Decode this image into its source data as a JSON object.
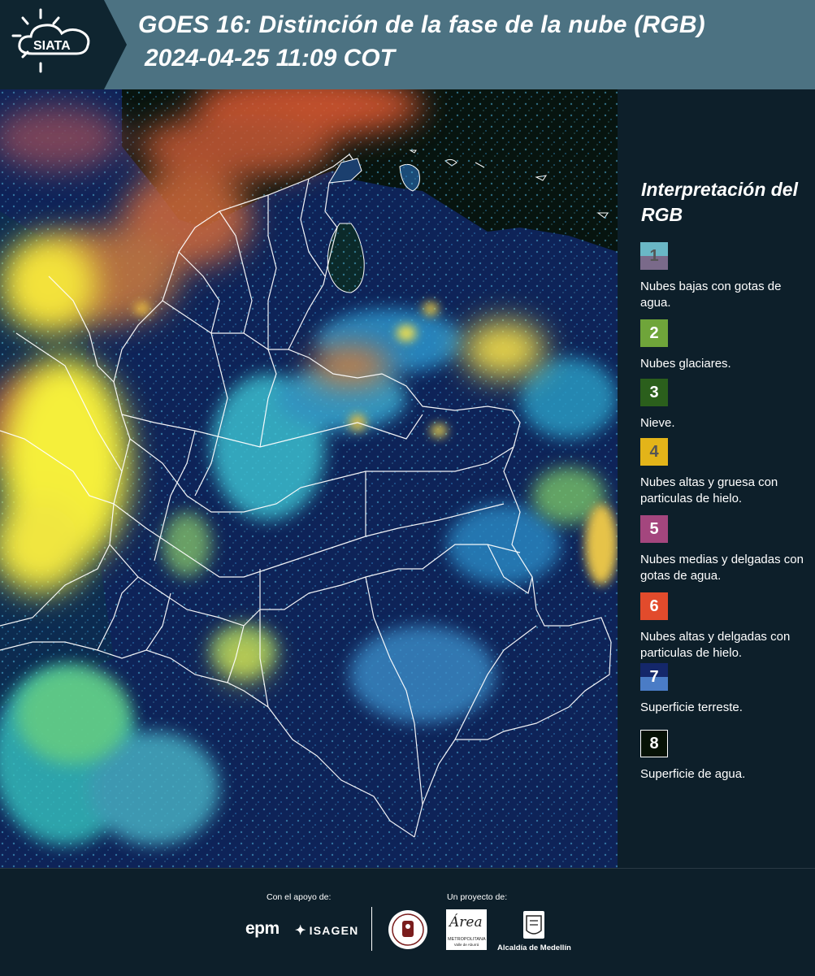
{
  "header": {
    "logo_text": "SIATA",
    "title_line1": "GOES 16: Distinción de la fase de la nube (RGB)",
    "title_line2": "2024-04-25 11:09 COT",
    "background_color": "#4c7282"
  },
  "legend": {
    "title": "Interpretación del RGB",
    "items": [
      {
        "number": "1",
        "label": "Nubes bajas con gotas de agua.",
        "color_top": "#6ab7c6",
        "color_bottom": "#7a6a8a",
        "text_color": "#555555"
      },
      {
        "number": "2",
        "label": "Nubes glaciares.",
        "color_top": "#6fa53a",
        "color_bottom": "#6fa53a",
        "text_color": "#ffffff"
      },
      {
        "number": "3",
        "label": "Nieve.",
        "color_top": "#2b5f1c",
        "color_bottom": "#2b5f1c",
        "text_color": "#ffffff"
      },
      {
        "number": "4",
        "label": "Nubes altas y gruesa con particulas de hielo.",
        "color_top": "#e3b419",
        "color_bottom": "#e3b419",
        "text_color": "#555555"
      },
      {
        "number": "5",
        "label": "Nubes medias y delgadas con gotas de agua.",
        "color_top": "#a4467e",
        "color_bottom": "#a4467e",
        "text_color": "#ffffff"
      },
      {
        "number": "6",
        "label": "Nubes altas y delgadas con particulas de hielo.",
        "color_top": "#e24b2c",
        "color_bottom": "#e24b2c",
        "text_color": "#ffffff"
      },
      {
        "number": "7",
        "label": "Superficie terreste.",
        "color_top": "#14276a",
        "color_bottom": "#4a7cc6",
        "text_color": "#ffffff"
      },
      {
        "number": "8",
        "label": "Superficie de agua.",
        "color_top": "#061206",
        "color_bottom": "#061206",
        "text_color": "#ffffff"
      }
    ]
  },
  "footer": {
    "support_label": "Con el apoyo de:",
    "project_label": "Un proyecto de:",
    "epm_text": "epm",
    "isagen_text": "ISAGEN",
    "area_script": "Área",
    "area_line1": "METROPOLITANA",
    "area_line2": "Valle de Aburrá",
    "medellin_caption": "Alcaldía de Medellín"
  },
  "map": {
    "product": "GOES 16 cloud phase distinction RGB",
    "region": "Colombia and surroundings"
  }
}
